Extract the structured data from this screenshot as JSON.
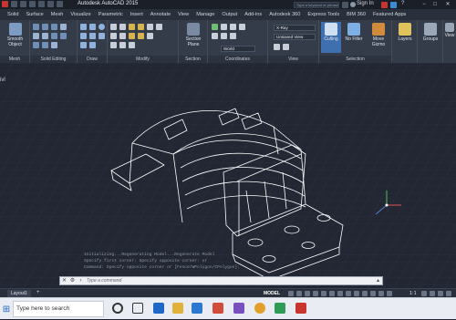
{
  "window": {
    "title": "Autodesk AutoCAD 2015",
    "search_placeholder": "Type a keyword or phrase",
    "signin_label": "Sign In",
    "help_label": "?",
    "minimize": "−",
    "maximize": "□",
    "close": "✕"
  },
  "tabs": [
    {
      "label": "Solid",
      "active": false
    },
    {
      "label": "Surface",
      "active": false
    },
    {
      "label": "Mesh",
      "active": false
    },
    {
      "label": "Visualize",
      "active": false
    },
    {
      "label": "Parametric",
      "active": false
    },
    {
      "label": "Insert",
      "active": false
    },
    {
      "label": "Annotate",
      "active": false
    },
    {
      "label": "View",
      "active": false
    },
    {
      "label": "Manage",
      "active": false
    },
    {
      "label": "Output",
      "active": false
    },
    {
      "label": "Add-ins",
      "active": false
    },
    {
      "label": "Autodesk 360",
      "active": false
    },
    {
      "label": "Express Tools",
      "active": false
    },
    {
      "label": "BIM 360",
      "active": false
    },
    {
      "label": "Featured Apps",
      "active": false
    }
  ],
  "ribbon": {
    "mesh": {
      "smooth_object": "Smooth Object",
      "caption": "Mesh"
    },
    "solid_editing": {
      "caption": "Solid Editing"
    },
    "draw": {
      "caption": "Draw"
    },
    "modify": {
      "caption": "Modify"
    },
    "section": {
      "section_plane": "Section Plane",
      "caption": "Section"
    },
    "coordinates": {
      "world": "World",
      "caption": "Coordinates"
    },
    "view": {
      "visual_style": "X-Ray",
      "saved_view": "Unsaved View",
      "caption": "View"
    },
    "selection": {
      "culling": "Culling",
      "no_filter": "No Filter",
      "move_gizmo": "Move Gizmo",
      "caption": "Selection"
    },
    "layers": {
      "label": "Layers"
    },
    "groups": {
      "label": "Groups"
    },
    "view_extra": {
      "label": "View"
    }
  },
  "viewport": {
    "label": "ivl"
  },
  "command": {
    "history": [
      "Initializing...Regenerating Model...Regenerate Model",
      "Specify first corner: Specify opposite corner: or",
      "Command: Specify opposite corner or [Fence/WPolygon/CPolygon]:"
    ],
    "placeholder": "Type a command"
  },
  "layout_tabs": [
    "Layout1"
  ],
  "status": {
    "model_label": "MODEL",
    "scale": "1:1"
  },
  "taskbar": {
    "search": "Type here to search"
  },
  "colors": {
    "accent": "#1e66c8",
    "viewport_bg": "#222733",
    "ribbon_bg": "#343b49",
    "wireframe": "#ffffff"
  }
}
